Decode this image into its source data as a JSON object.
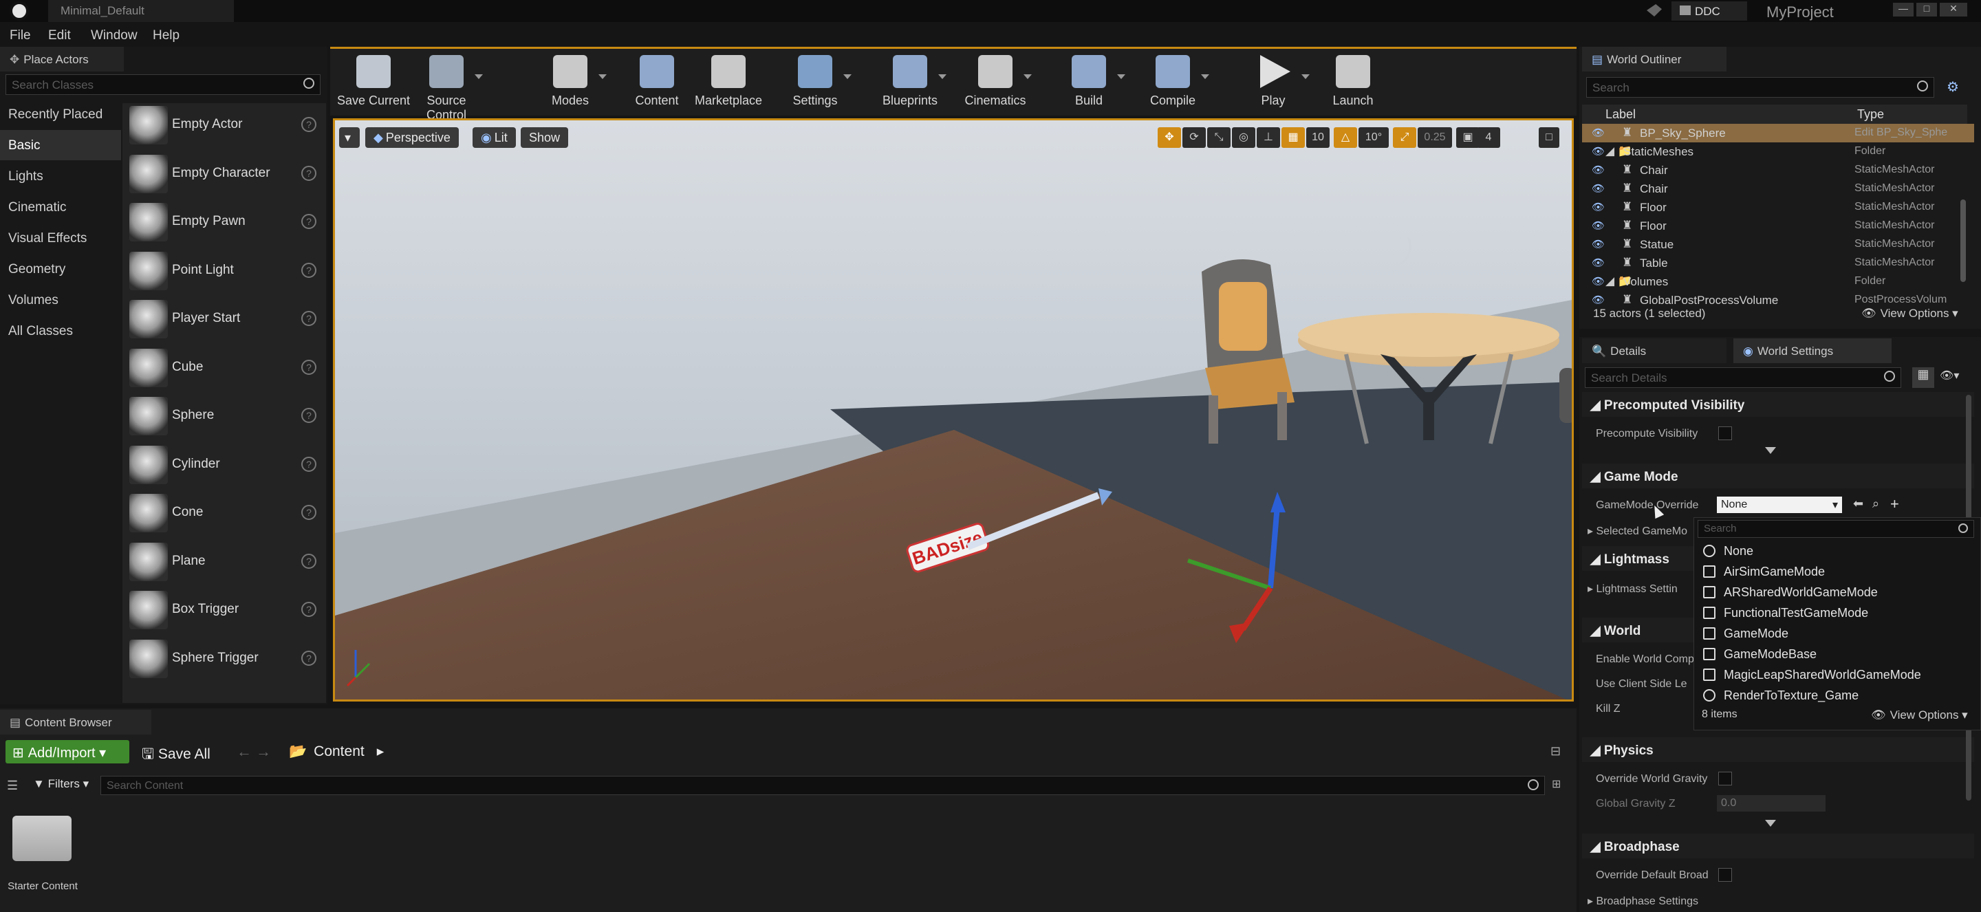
{
  "window": {
    "doc_tab": "Minimal_Default",
    "ddc": "DDC",
    "project": "MyProject"
  },
  "menu": [
    "File",
    "Edit",
    "Window",
    "Help"
  ],
  "place_actors": {
    "tab": "Place Actors",
    "search_placeholder": "Search Classes",
    "categories": [
      "Recently Placed",
      "Basic",
      "Lights",
      "Cinematic",
      "Visual Effects",
      "Geometry",
      "Volumes",
      "All Classes"
    ],
    "selected_category": "Basic",
    "actors": [
      "Empty Actor",
      "Empty Character",
      "Empty Pawn",
      "Point Light",
      "Player Start",
      "Cube",
      "Sphere",
      "Cylinder",
      "Cone",
      "Plane",
      "Box Trigger",
      "Sphere Trigger"
    ]
  },
  "toolbar": {
    "buttons": [
      {
        "label": "Save Current",
        "icon": "save-icon",
        "color": "#bfc6cf"
      },
      {
        "label": "Source Control",
        "icon": "source-control-icon",
        "color": "#9aa7b6"
      },
      {
        "label": "Modes",
        "icon": "modes-icon",
        "color": "#c9c9c9"
      },
      {
        "label": "Content",
        "icon": "content-icon",
        "color": "#8fa8cc"
      },
      {
        "label": "Marketplace",
        "icon": "marketplace-icon",
        "color": "#c9c9c9"
      },
      {
        "label": "Settings",
        "icon": "settings-icon",
        "color": "#7ea0c8"
      },
      {
        "label": "Blueprints",
        "icon": "blueprints-icon",
        "color": "#8fa8cc"
      },
      {
        "label": "Cinematics",
        "icon": "cinematics-icon",
        "color": "#c9c9c9"
      },
      {
        "label": "Build",
        "icon": "build-icon",
        "color": "#8fa8cc"
      },
      {
        "label": "Compile",
        "icon": "compile-icon",
        "color": "#8fa8cc"
      },
      {
        "label": "Play",
        "icon": "play-icon",
        "color": "#e0e0e0"
      },
      {
        "label": "Launch",
        "icon": "launch-icon",
        "color": "#c9c9c9"
      }
    ]
  },
  "viewport": {
    "perspective": "Perspective",
    "lit": "Lit",
    "show": "Show",
    "grid_snap": "10",
    "rotation_snap": "10°",
    "scale_snap": "0.25",
    "camera_speed": "4",
    "bad_size_label": "BADsize"
  },
  "outliner": {
    "tab": "World Outliner",
    "search_placeholder": "Search",
    "col_label": "Label",
    "col_type": "Type",
    "rows": [
      {
        "label": "BP_Sky_Sphere",
        "type": "Edit BP_Sky_Sphe",
        "indent": 3
      },
      {
        "label": "StaticMeshes",
        "type": "Folder",
        "indent": 2
      },
      {
        "label": "Chair",
        "type": "StaticMeshActor",
        "indent": 3
      },
      {
        "label": "Chair",
        "type": "StaticMeshActor",
        "indent": 3
      },
      {
        "label": "Floor",
        "type": "StaticMeshActor",
        "indent": 3
      },
      {
        "label": "Floor",
        "type": "StaticMeshActor",
        "indent": 3
      },
      {
        "label": "Statue",
        "type": "StaticMeshActor",
        "indent": 3
      },
      {
        "label": "Table",
        "type": "StaticMeshActor",
        "indent": 3
      },
      {
        "label": "Volumes",
        "type": "Folder",
        "indent": 2
      },
      {
        "label": "GlobalPostProcessVolume",
        "type": "PostProcessVolum",
        "indent": 3
      }
    ],
    "status": "15 actors (1 selected)",
    "view_options": "View Options"
  },
  "details": {
    "tab_details": "Details",
    "tab_world_settings": "World Settings",
    "search_placeholder": "Search Details",
    "sections": {
      "precomputed_visibility": "Precomputed Visibility",
      "precompute_visibility": "Precompute Visibility",
      "game_mode": "Game Mode",
      "gamemode_override": "GameMode Override",
      "gamemode_value": "None",
      "selected_gamemode": "Selected GameMo",
      "lightmass": "Lightmass",
      "lightmass_settings": "Lightmass Settin",
      "world": "World",
      "enable_world_comp": "Enable World Comp",
      "use_client_side": "Use Client Side Le",
      "kill_z": "Kill Z",
      "physics": "Physics",
      "override_world_gravity": "Override World Gravity",
      "global_gravity_z": "Global Gravity Z",
      "global_gravity_value": "0.0",
      "broadphase": "Broadphase",
      "override_default_broad": "Override Default Broad",
      "broadphase_settings": "Broadphase Settings"
    }
  },
  "gamemode_dropdown": {
    "search_placeholder": "Search",
    "items": [
      "None",
      "AirSimGameMode",
      "ARSharedWorldGameMode",
      "FunctionalTestGameMode",
      "GameMode",
      "GameModeBase",
      "MagicLeapSharedWorldGameMode",
      "RenderToTexture_Game"
    ],
    "count": "8 items",
    "view_options": "View Options"
  },
  "content_browser": {
    "tab": "Content Browser",
    "add_import": "Add/Import",
    "save_all": "Save All",
    "path": "Content",
    "filters": "Filters",
    "search_placeholder": "Search Content",
    "folders": [
      "Starter Content"
    ]
  }
}
